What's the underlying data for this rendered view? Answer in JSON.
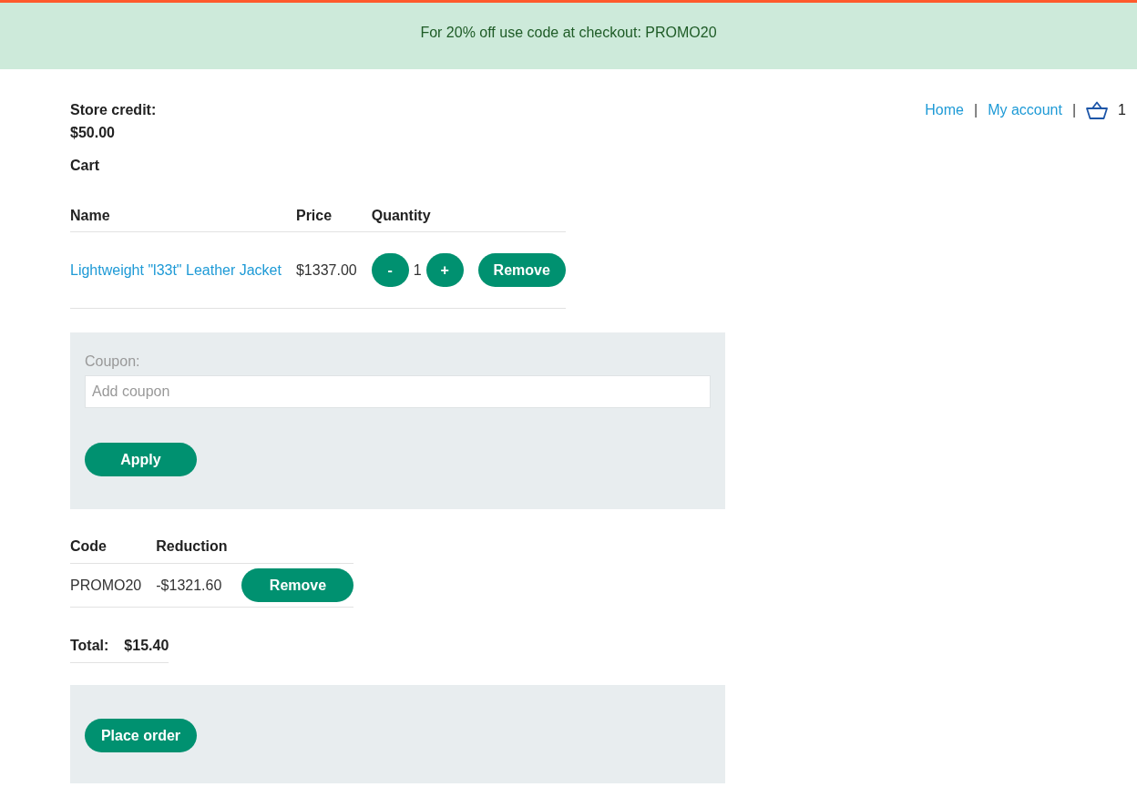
{
  "banner": {
    "text": "For 20% off use code at checkout: PROMO20"
  },
  "store_credit": {
    "label": "Store credit:",
    "value": "$50.00"
  },
  "nav": {
    "items": [
      {
        "kind": "link",
        "label": "Home"
      },
      {
        "kind": "separator",
        "label": "|"
      },
      {
        "kind": "link",
        "label": "My account"
      },
      {
        "kind": "separator",
        "label": "|"
      },
      {
        "kind": "cart",
        "count": "1"
      }
    ]
  },
  "cart": {
    "title": "Cart",
    "columns": [
      "Name",
      "Price",
      "Quantity"
    ],
    "rows": [
      {
        "name": "Lightweight \"l33t\" Leather Jacket",
        "price": "$1337.00",
        "decrement": "-",
        "quantity": "1",
        "increment": "+",
        "remove": "Remove"
      }
    ]
  },
  "coupon_form": {
    "label": "Coupon:",
    "placeholder": "Add coupon",
    "button": "Apply"
  },
  "coupons": {
    "columns": [
      "Code",
      "Reduction"
    ],
    "rows": [
      {
        "code": "PROMO20",
        "reduction": "-$1321.60",
        "remove": "Remove"
      }
    ]
  },
  "total": {
    "label": "Total:",
    "value": "$15.40"
  },
  "checkout": {
    "button": "Place order"
  }
}
